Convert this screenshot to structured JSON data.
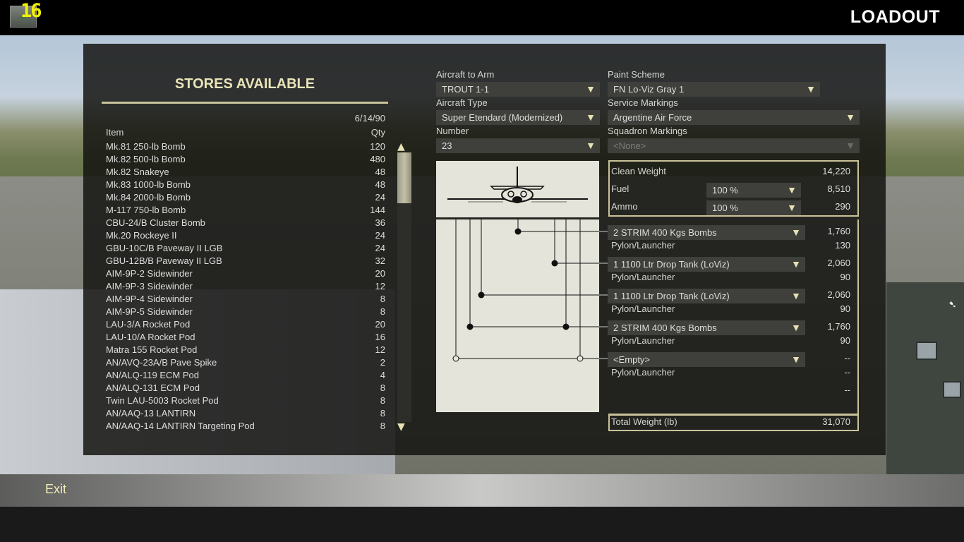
{
  "header": {
    "version": "16",
    "screen_title": "LOADOUT"
  },
  "stores": {
    "title": "STORES AVAILABLE",
    "date": "6/14/90",
    "col_item": "Item",
    "col_qty": "Qty",
    "items": [
      {
        "name": "Mk.81 250-lb Bomb",
        "qty": "120"
      },
      {
        "name": "Mk.82 500-lb Bomb",
        "qty": "480"
      },
      {
        "name": "Mk.82 Snakeye",
        "qty": "48"
      },
      {
        "name": "Mk.83 1000-lb Bomb",
        "qty": "48"
      },
      {
        "name": "Mk.84 2000-lb Bomb",
        "qty": "24"
      },
      {
        "name": "M-117 750-lb Bomb",
        "qty": "144"
      },
      {
        "name": "CBU-24/B Cluster Bomb",
        "qty": "36"
      },
      {
        "name": "Mk.20 Rockeye II",
        "qty": "24"
      },
      {
        "name": "GBU-10C/B Paveway II LGB",
        "qty": "24"
      },
      {
        "name": "GBU-12B/B Paveway II LGB",
        "qty": "32"
      },
      {
        "name": "AIM-9P-2 Sidewinder",
        "qty": "20"
      },
      {
        "name": "AIM-9P-3 Sidewinder",
        "qty": "12"
      },
      {
        "name": "AIM-9P-4 Sidewinder",
        "qty": "8"
      },
      {
        "name": "AIM-9P-5 Sidewinder",
        "qty": "8"
      },
      {
        "name": "LAU-3/A Rocket Pod",
        "qty": "20"
      },
      {
        "name": "LAU-10/A Rocket Pod",
        "qty": "16"
      },
      {
        "name": "Matra 155 Rocket Pod",
        "qty": "12"
      },
      {
        "name": "AN/AVQ-23A/B Pave Spike",
        "qty": "2"
      },
      {
        "name": "AN/ALQ-119 ECM Pod",
        "qty": "4"
      },
      {
        "name": "AN/ALQ-131 ECM Pod",
        "qty": "8"
      },
      {
        "name": "Twin LAU-5003 Rocket Pod",
        "qty": "8"
      },
      {
        "name": "AN/AAQ-13 LANTIRN",
        "qty": "8"
      },
      {
        "name": "AN/AAQ-14 LANTIRN Targeting Pod",
        "qty": "8"
      }
    ]
  },
  "config": {
    "aircraft_to_arm_label": "Aircraft to Arm",
    "aircraft_to_arm": "TROUT 1-1",
    "aircraft_type_label": "Aircraft Type",
    "aircraft_type": "Super Etendard (Modernized)",
    "number_label": "Number",
    "number": "23",
    "paint_scheme_label": "Paint Scheme",
    "paint_scheme": "FN Lo-Viz Gray 1",
    "service_markings_label": "Service Markings",
    "service_markings": "Argentine Air Force",
    "squadron_markings_label": "Squadron Markings",
    "squadron_markings": "<None>"
  },
  "weights": {
    "clean_weight_label": "Clean Weight",
    "clean_weight": "14,220",
    "fuel_label": "Fuel",
    "fuel_pct": "100 %",
    "fuel_weight": "8,510",
    "ammo_label": "Ammo",
    "ammo_pct": "100 %",
    "ammo_weight": "290",
    "total_label": "Total Weight (lb)",
    "total": "31,070"
  },
  "stations": [
    {
      "store": "2 STRIM 400 Kgs Bombs",
      "store_weight": "1,760",
      "pylon_label": "Pylon/Launcher",
      "pylon_weight": "130"
    },
    {
      "store": "1 1100 Ltr Drop Tank (LoViz)",
      "store_weight": "2,060",
      "pylon_label": "Pylon/Launcher",
      "pylon_weight": "90"
    },
    {
      "store": "1 1100 Ltr Drop Tank (LoViz)",
      "store_weight": "2,060",
      "pylon_label": "Pylon/Launcher",
      "pylon_weight": "90"
    },
    {
      "store": "2 STRIM 400 Kgs Bombs",
      "store_weight": "1,760",
      "pylon_label": "Pylon/Launcher",
      "pylon_weight": "90"
    },
    {
      "store": "<Empty>",
      "store_weight": "--",
      "pylon_label": "Pylon/Launcher",
      "pylon_weight": "--",
      "extra_weight": "--"
    }
  ],
  "footer": {
    "exit_label": "Exit"
  },
  "colors": {
    "accent": "#c9c39a",
    "version_yellow": "#f2f200",
    "panel": "#12120f"
  }
}
